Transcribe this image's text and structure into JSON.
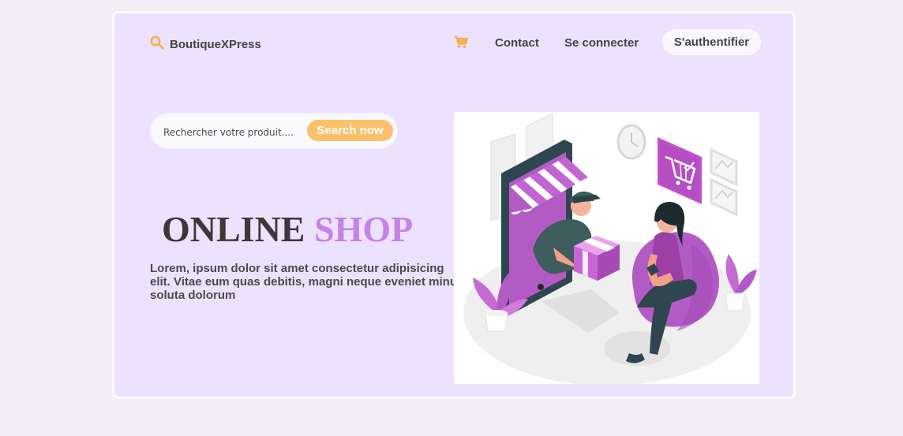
{
  "header": {
    "brand": "BoutiqueXPress",
    "nav": {
      "contact": "Contact",
      "login": "Se connecter"
    },
    "auth_button": "S'authentifier"
  },
  "search": {
    "placeholder": "Rechercher votre produit....",
    "button": "Search now"
  },
  "hero": {
    "title_part1": "ONLINE",
    "title_part2": "SHOP",
    "description": "Lorem, ipsum dolor sit amet consectetur adipisicing elit. Vitae eum quas debitis, magni neque eveniet minus soluta dolorum"
  },
  "icons": {
    "logo": "search-icon",
    "cart": "cart-icon"
  },
  "colors": {
    "page_bg": "#f1eff5",
    "card_bg": "#ece2fd",
    "accent_orange": "#fbc06a",
    "accent_purple": "#c682e6",
    "shop_purple": "#b35bc4",
    "text_dark": "#444444"
  }
}
